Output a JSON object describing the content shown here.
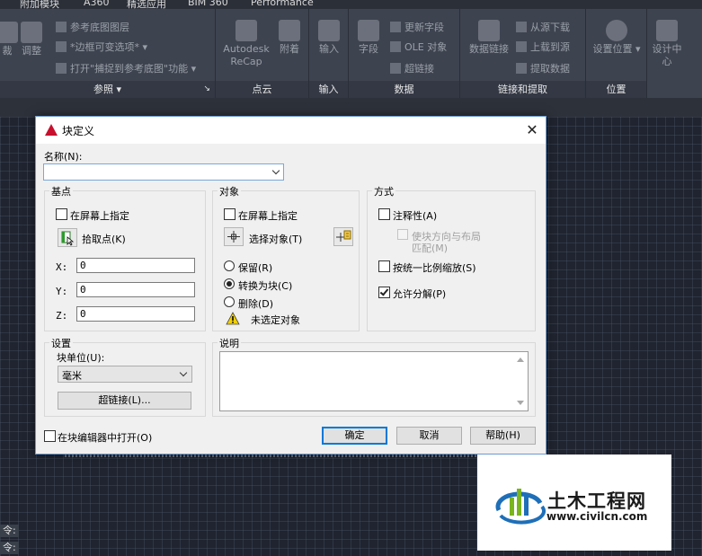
{
  "menubar": {
    "items": [
      "附加模块",
      "A360",
      "精选应用",
      "BIM 360",
      "Performance"
    ]
  },
  "ribbon": {
    "panels": [
      {
        "title": "参照"
      },
      {
        "title": "点云"
      },
      {
        "title": "输入"
      },
      {
        "title": "数据"
      },
      {
        "title": "链接和提取"
      },
      {
        "title": "位置"
      }
    ],
    "items": {
      "left_cut_1": "裁",
      "adjust": "调整",
      "ref_underlay_layers": "参考底图图层",
      "frame_variable": "*边框可变选项*",
      "snap_underlay": "打开\"捕捉到参考底图\"功能",
      "recap": "Autodesk ReCap",
      "attach": "附着",
      "import": "输入",
      "field": "字段",
      "update_fields": "更新字段",
      "ole_object": "OLE 对象",
      "hyperlink": "超链接",
      "data_link": "数据链接",
      "download_source": "从源下载",
      "upload_source": "上载到源",
      "extract_data": "提取数据",
      "set_location": "设置位置",
      "design_center": "设计中心"
    }
  },
  "command_lines": [
    "令:",
    "令:"
  ],
  "dialog": {
    "title": "块定义",
    "name_label": "名称(N):",
    "name_value": "",
    "base_point": {
      "title": "基点",
      "specify_on_screen": "在屏幕上指定",
      "pick_point": "拾取点(K)",
      "x_label": "X:",
      "y_label": "Y:",
      "z_label": "Z:",
      "x": "0",
      "y": "0",
      "z": "0"
    },
    "objects": {
      "title": "对象",
      "specify_on_screen": "在屏幕上指定",
      "select_objects": "选择对象(T)",
      "retain": "保留(R)",
      "convert_to_block": "转换为块(C)",
      "delete": "删除(D)",
      "warning": "未选定对象"
    },
    "behavior": {
      "title": "方式",
      "annotative": "注释性(A)",
      "match_orientation_line1": "使块方向与布局",
      "match_orientation_line2": "匹配(M)",
      "scale_uniformly": "按统一比例缩放(S)",
      "allow_exploding": "允许分解(P)"
    },
    "settings": {
      "title": "设置",
      "block_unit_label": "块单位(U):",
      "block_unit_value": "毫米",
      "hyperlink_button": "超链接(L)..."
    },
    "description": {
      "title": "说明",
      "value": ""
    },
    "open_in_editor": "在块编辑器中打开(O)",
    "buttons": {
      "ok": "确定",
      "cancel": "取消",
      "help": "帮助(H)"
    }
  },
  "watermark": {
    "title": "土木工程网",
    "url": "www.civilcn.com"
  }
}
